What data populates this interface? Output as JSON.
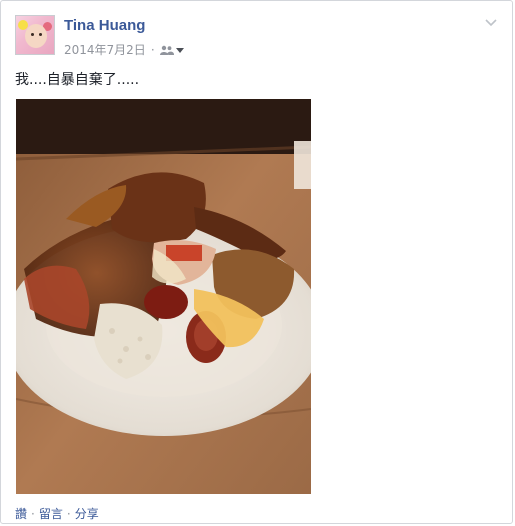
{
  "post": {
    "author": "Tina Huang",
    "date": "2014年7月2日",
    "separator": "·",
    "text": "我....自暴自棄了.....",
    "audience_icon": "friends-icon",
    "menu_icon": "chevron-down-icon"
  },
  "actions": {
    "like": "讚",
    "comment": "留言",
    "share": "分享",
    "separator": "·"
  },
  "colors": {
    "author": "#3b5998",
    "meta": "#90949c",
    "text": "#1d2129",
    "border": "#d3d6db"
  }
}
